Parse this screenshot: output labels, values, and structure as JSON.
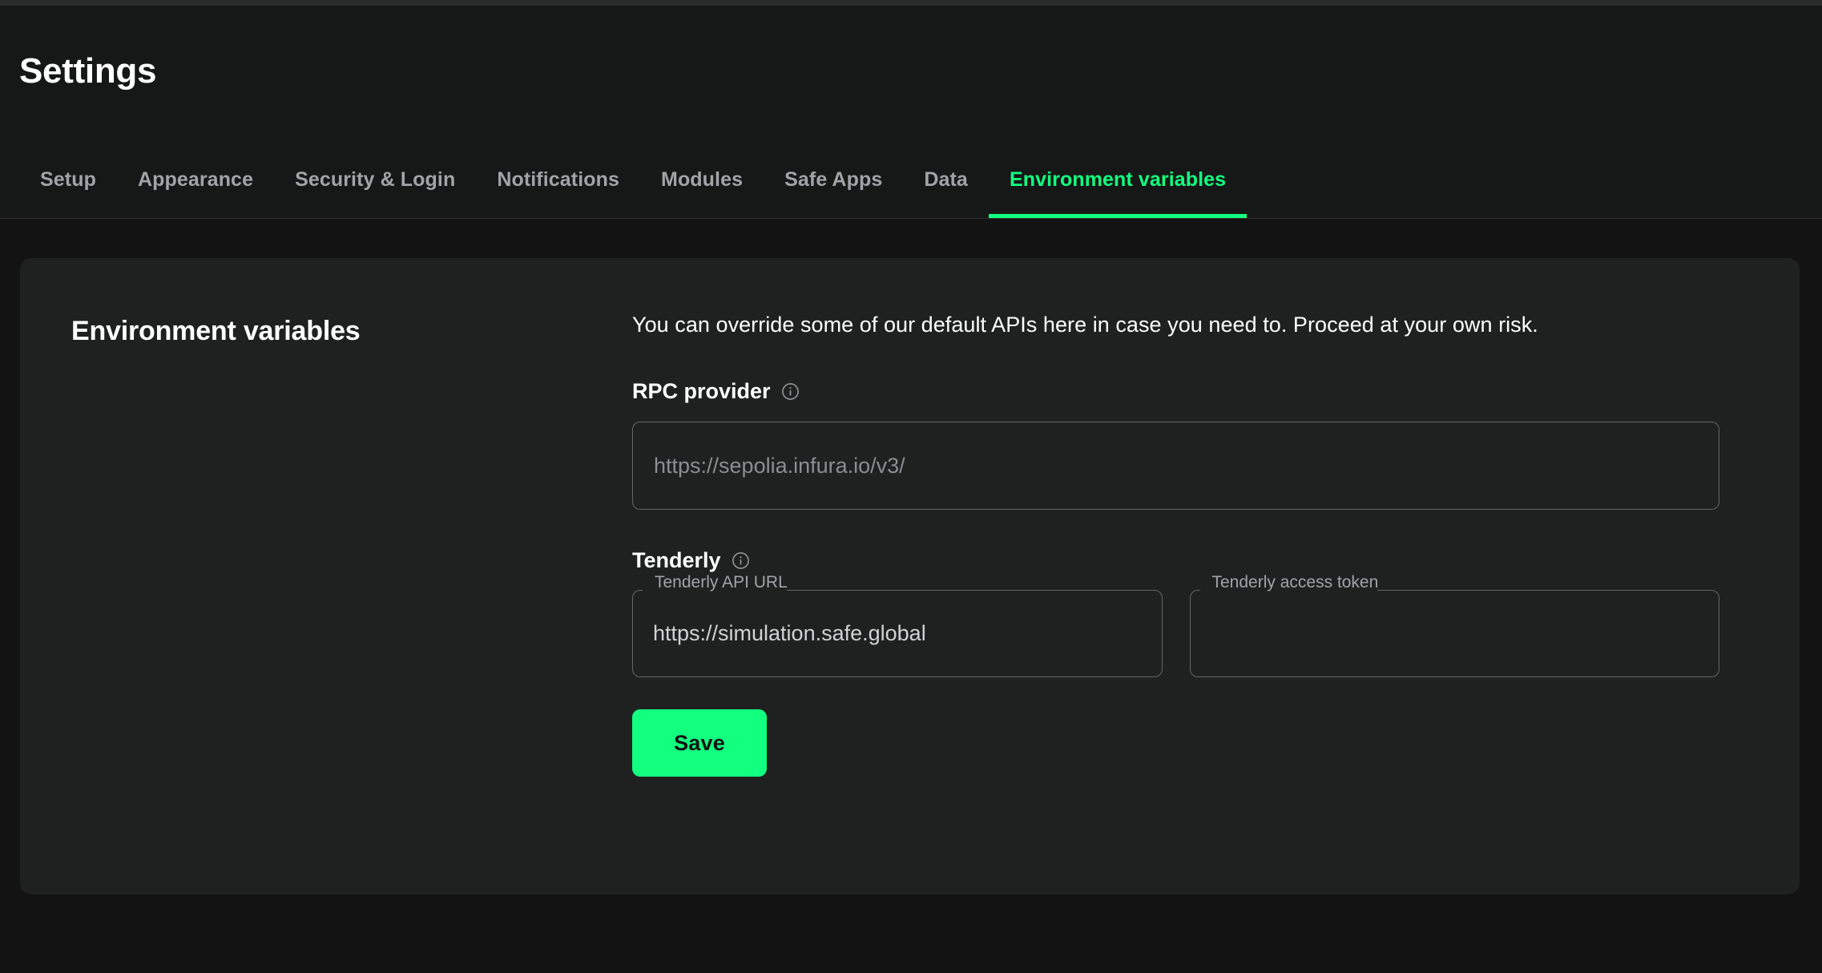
{
  "header": {
    "title": "Settings",
    "tabs": [
      {
        "label": "Setup",
        "active": false
      },
      {
        "label": "Appearance",
        "active": false
      },
      {
        "label": "Security & Login",
        "active": false
      },
      {
        "label": "Notifications",
        "active": false
      },
      {
        "label": "Modules",
        "active": false
      },
      {
        "label": "Safe Apps",
        "active": false
      },
      {
        "label": "Data",
        "active": false
      },
      {
        "label": "Environment variables",
        "active": true
      }
    ]
  },
  "card": {
    "section_title": "Environment variables",
    "intro": "You can override some of our default APIs here in case you need to. Proceed at your own risk.",
    "rpc": {
      "label": "RPC provider",
      "info_icon": "info-circle-icon",
      "value": "",
      "placeholder": "https://sepolia.infura.io/v3/"
    },
    "tenderly": {
      "label": "Tenderly",
      "info_icon": "info-circle-icon",
      "api_url": {
        "label": "Tenderly API URL",
        "value": "https://simulation.safe.global",
        "placeholder": ""
      },
      "access_token": {
        "label": "Tenderly access token",
        "value": "",
        "placeholder": ""
      }
    },
    "save_label": "Save"
  },
  "colors": {
    "accent_green": "#12ff80",
    "page_background": "#121312",
    "card_background": "#1f2120",
    "header_background": "#161817",
    "border": "#636669",
    "muted_text": "#a1a3a7"
  }
}
